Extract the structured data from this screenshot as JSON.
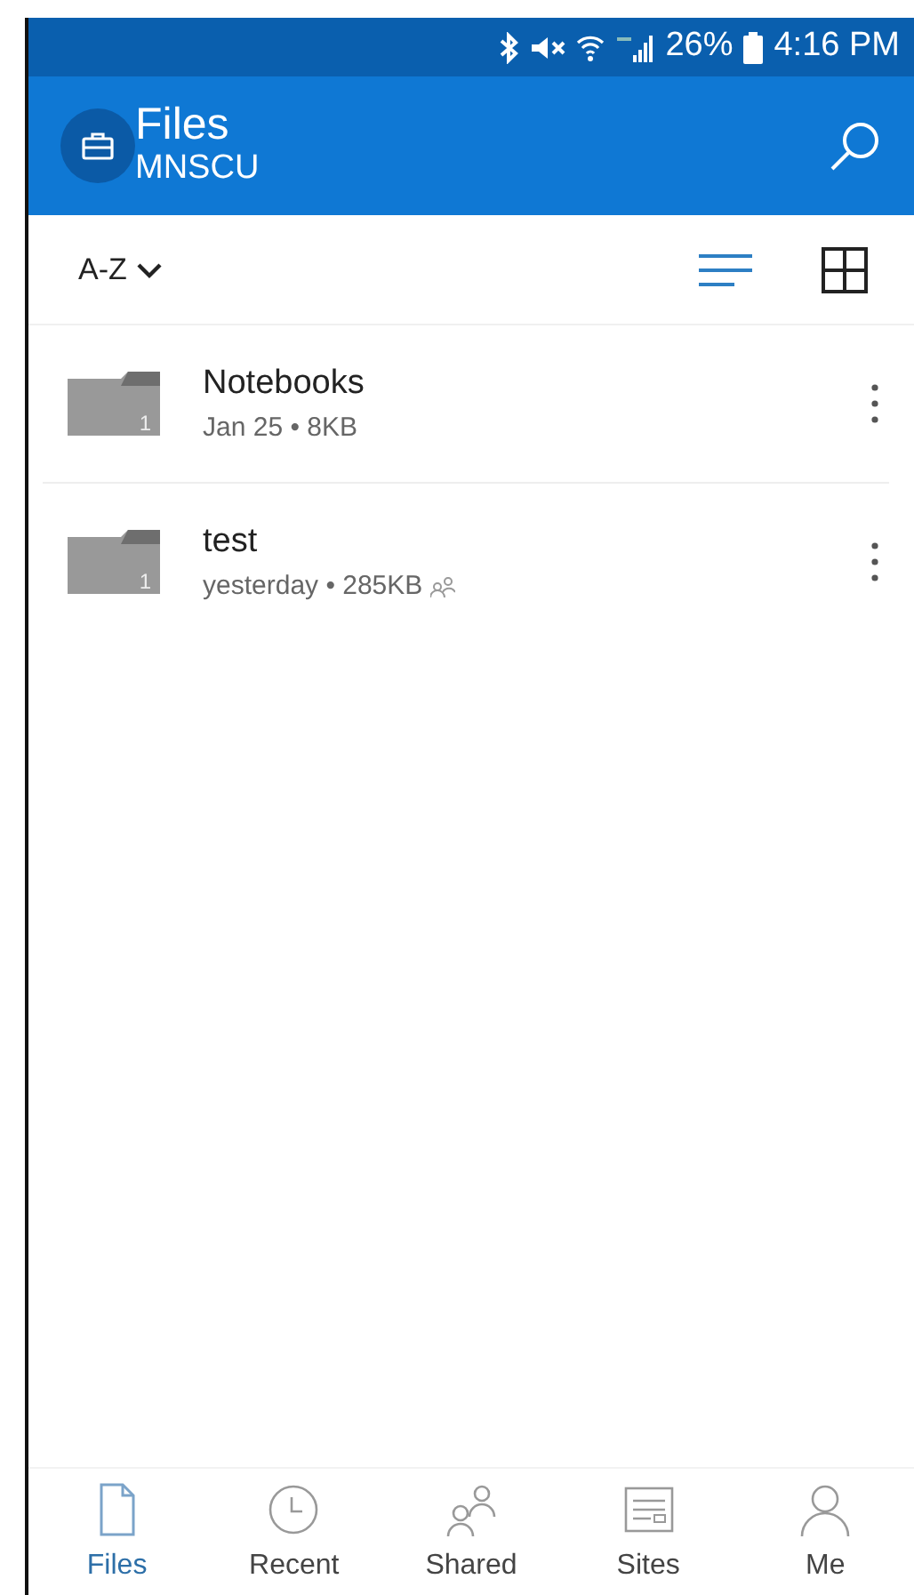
{
  "status_bar": {
    "battery": "26%",
    "time": "4:16 PM"
  },
  "header": {
    "title": "Files",
    "subtitle": "MNSCU"
  },
  "toolbar": {
    "sort": "A-Z",
    "views": [
      {
        "kind": "list",
        "selected": true
      },
      {
        "kind": "grid",
        "selected": false
      }
    ]
  },
  "files": [
    {
      "name": "Notebooks",
      "meta": "Jan 25 • 8KB",
      "count": "1",
      "shared": false
    },
    {
      "name": "test",
      "meta": "yesterday • 285KB",
      "count": "1",
      "shared": true
    }
  ],
  "nav": [
    {
      "kind": "files",
      "label": "Files",
      "selected": true
    },
    {
      "kind": "recent",
      "label": "Recent",
      "selected": false
    },
    {
      "kind": "shared",
      "label": "Shared",
      "selected": false
    },
    {
      "kind": "sites",
      "label": "Sites",
      "selected": false
    },
    {
      "kind": "me",
      "label": "Me",
      "selected": false
    }
  ]
}
